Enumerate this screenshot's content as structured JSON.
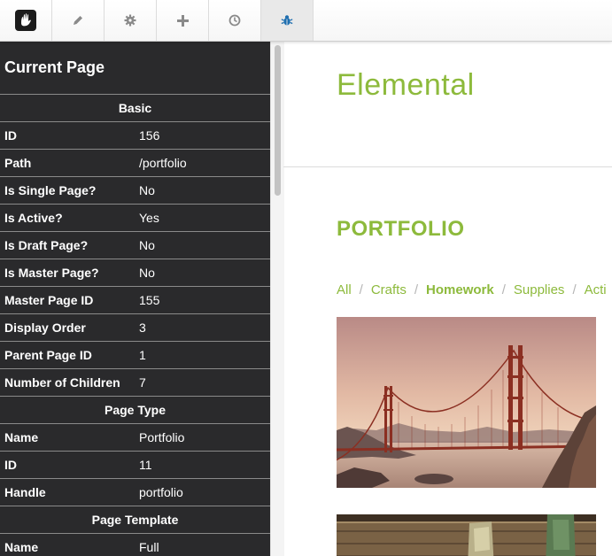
{
  "toolbar": {
    "items": [
      {
        "name": "logo-button",
        "icon": "concrete-hand-icon"
      },
      {
        "name": "edit-button",
        "icon": "pencil-icon"
      },
      {
        "name": "settings-button",
        "icon": "gear-icon"
      },
      {
        "name": "add-button",
        "icon": "plus-icon"
      },
      {
        "name": "history-button",
        "icon": "clock-icon"
      },
      {
        "name": "debug-button",
        "icon": "bug-icon",
        "active": true
      }
    ],
    "accent": "#1f6fb0"
  },
  "sidebar": {
    "title": "Current Page",
    "basic": {
      "header": "Basic",
      "rows": [
        {
          "key": "ID",
          "value": "156"
        },
        {
          "key": "Path",
          "value": "/portfolio"
        },
        {
          "key": "Is Single Page?",
          "value": "No"
        },
        {
          "key": "Is Active?",
          "value": "Yes"
        },
        {
          "key": "Is Draft Page?",
          "value": "No"
        },
        {
          "key": "Is Master Page?",
          "value": "No"
        },
        {
          "key": "Master Page ID",
          "value": "155"
        },
        {
          "key": "Display Order",
          "value": "3"
        },
        {
          "key": "Parent Page ID",
          "value": "1"
        },
        {
          "key": "Number of Children",
          "value": "7"
        }
      ]
    },
    "page_type": {
      "header": "Page Type",
      "rows": [
        {
          "key": "Name",
          "value": "Portfolio"
        },
        {
          "key": "ID",
          "value": "11"
        },
        {
          "key": "Handle",
          "value": "portfolio"
        }
      ]
    },
    "page_template": {
      "header": "Page Template",
      "rows": [
        {
          "key": "Name",
          "value": "Full"
        }
      ]
    }
  },
  "main": {
    "site_title": "Elemental",
    "heading": "PORTFOLIO",
    "filters": [
      {
        "label": "All"
      },
      {
        "label": "Crafts"
      },
      {
        "label": "Homework",
        "current": true
      },
      {
        "label": "Supplies"
      },
      {
        "label": "Acti"
      }
    ],
    "separator": "/",
    "accent": "#8dba3c"
  }
}
